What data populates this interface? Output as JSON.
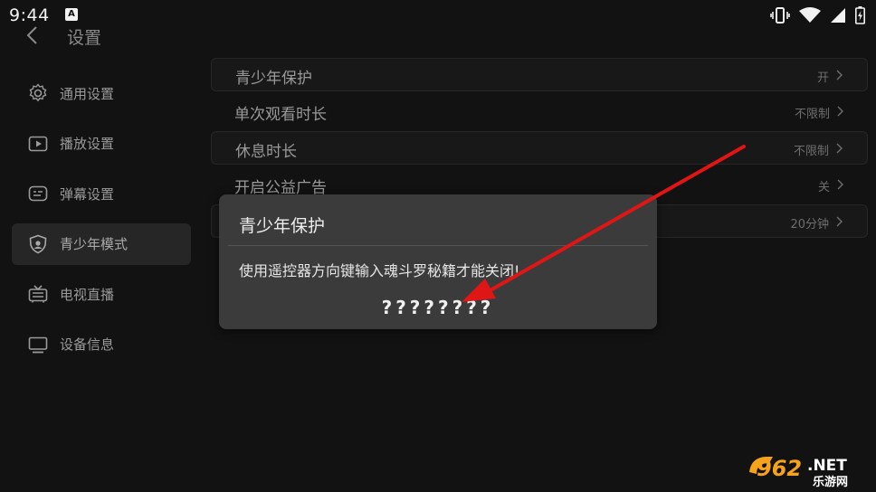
{
  "status_bar": {
    "time": "9:44",
    "notification_glyph": "A"
  },
  "header": {
    "title": "设置"
  },
  "sidebar": {
    "items": [
      {
        "label": "通用设置",
        "icon": "gear-icon"
      },
      {
        "label": "播放设置",
        "icon": "play-icon"
      },
      {
        "label": "弹幕设置",
        "icon": "danmaku-icon"
      },
      {
        "label": "青少年模式",
        "icon": "shield-icon",
        "active": true
      },
      {
        "label": "电视直播",
        "icon": "tv-antenna-icon"
      },
      {
        "label": "设备信息",
        "icon": "monitor-icon"
      }
    ]
  },
  "settings": {
    "rows": [
      {
        "label": "青少年保护",
        "value": "开"
      },
      {
        "label": "单次观看时长",
        "value": "不限制"
      },
      {
        "label": "休息时长",
        "value": "不限制"
      },
      {
        "label": "开启公益广告",
        "value": "关"
      },
      {
        "label": "",
        "value": "20分钟"
      }
    ]
  },
  "dialog": {
    "title": "青少年保护",
    "message": "使用遥控器方向键输入魂斗罗秘籍才能关闭!",
    "code": "????????"
  },
  "watermark": {
    "number": "962",
    "suffix": ".NET",
    "caption": "乐游网"
  },
  "colors": {
    "background": "#121212",
    "dialog": "#3b3b3b",
    "arrow": "#e01515",
    "watermark_orange": "#f7a21b"
  }
}
